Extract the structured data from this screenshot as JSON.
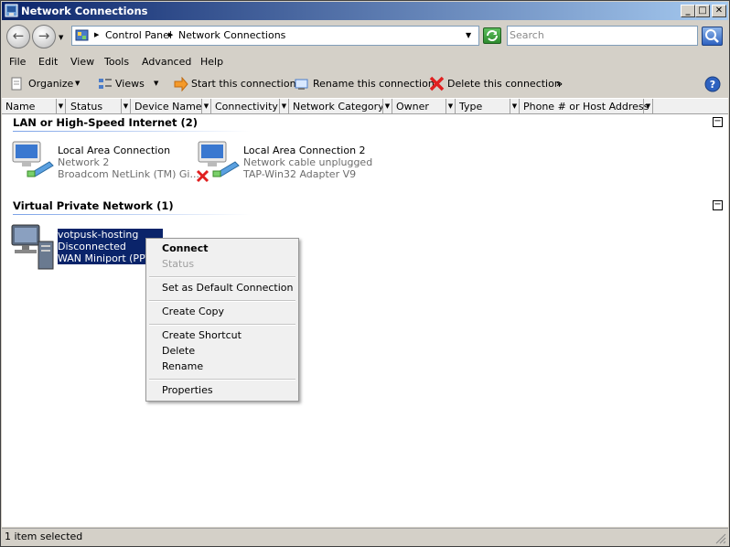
{
  "window": {
    "title": "Network Connections"
  },
  "address": {
    "parts": [
      "Control Panel",
      "Network Connections"
    ],
    "search_placeholder": "Search"
  },
  "menu": [
    "File",
    "Edit",
    "View",
    "Tools",
    "Advanced",
    "Help"
  ],
  "toolbar": {
    "organize": "Organize",
    "views": "Views",
    "start": "Start this connection",
    "rename": "Rename this connection",
    "delete": "Delete this connection",
    "more": "»"
  },
  "columns": [
    "Name",
    "Status",
    "Device Name",
    "Connectivity",
    "Network Category",
    "Owner",
    "Type",
    "Phone # or Host Address"
  ],
  "groups": [
    {
      "title": "LAN or High-Speed Internet (2)",
      "items": [
        {
          "name": "Local Area Connection",
          "status": "Network  2",
          "device": "Broadcom NetLink (TM) Gi..."
        },
        {
          "name": "Local Area Connection 2",
          "status": "Network cable unplugged",
          "device": "TAP-Win32 Adapter V9"
        }
      ]
    },
    {
      "title": "Virtual Private Network (1)",
      "items": [
        {
          "name": "votpusk-hosting",
          "status": "Disconnected",
          "device": "WAN Miniport (PPTP)"
        }
      ]
    }
  ],
  "context_menu": {
    "connect": "Connect",
    "status": "Status",
    "set_default": "Set as Default Connection",
    "create_copy": "Create Copy",
    "create_shortcut": "Create Shortcut",
    "delete": "Delete",
    "rename": "Rename",
    "properties": "Properties"
  },
  "status_bar": "1 item selected",
  "colors": {
    "titlebar_start": "#0a246a",
    "titlebar_end": "#a6caf0",
    "selection": "#0a246a",
    "delete_red": "#e02020"
  }
}
